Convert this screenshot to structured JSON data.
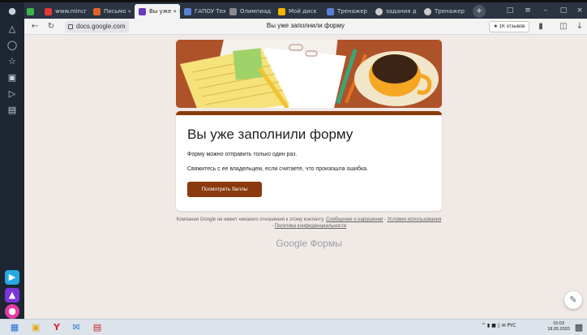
{
  "tabs": [
    {
      "label": "www.mincr",
      "color": "#4a90d9"
    },
    {
      "label": "Письмо «",
      "color": "#e0642a"
    },
    {
      "label": "Вы уже «",
      "color": "#673ab7",
      "close": "×"
    },
    {
      "label": "ГАПОУ Тех",
      "color": "#5b7fd6"
    },
    {
      "label": "Олимпиад",
      "color": "#8a8a8a"
    },
    {
      "label": "Мой диск",
      "color": "#f4b400"
    },
    {
      "label": "Тренажер",
      "color": "#5b7fd6"
    },
    {
      "label": "задания д",
      "color": "#cccccc"
    },
    {
      "label": "Тренажер",
      "color": "#cccccc"
    }
  ],
  "address": {
    "url": "docs.google.com",
    "page_title": "Вы уже заполнили форму",
    "reviews_label": "★ 1K отзывов"
  },
  "card": {
    "title": "Вы уже заполнили форму",
    "line1": "Форму можно отправить только один раз.",
    "line2": "Свяжитесь с ее владельцем, если считаете, что произошла ошибка.",
    "button": "Посмотреть баллы"
  },
  "footer": {
    "part1": "Компания Google не имеет никакого отношения к этому контенту.",
    "link_abuse": "Сообщение о нарушении",
    "sep": " - ",
    "link_terms": "Условия использования",
    "link_privacy": "Политика конфиденциальности",
    "logo": "Google Формы"
  },
  "tray": {
    "status": "^ ▮ ■ ◊ ✉ PYC",
    "time": "15:03",
    "date": "18.05.2020"
  },
  "colors": {
    "accent": "#8a3a0c",
    "page_bg": "#f0e9e6",
    "sidebar_bg": "#1d2632"
  }
}
